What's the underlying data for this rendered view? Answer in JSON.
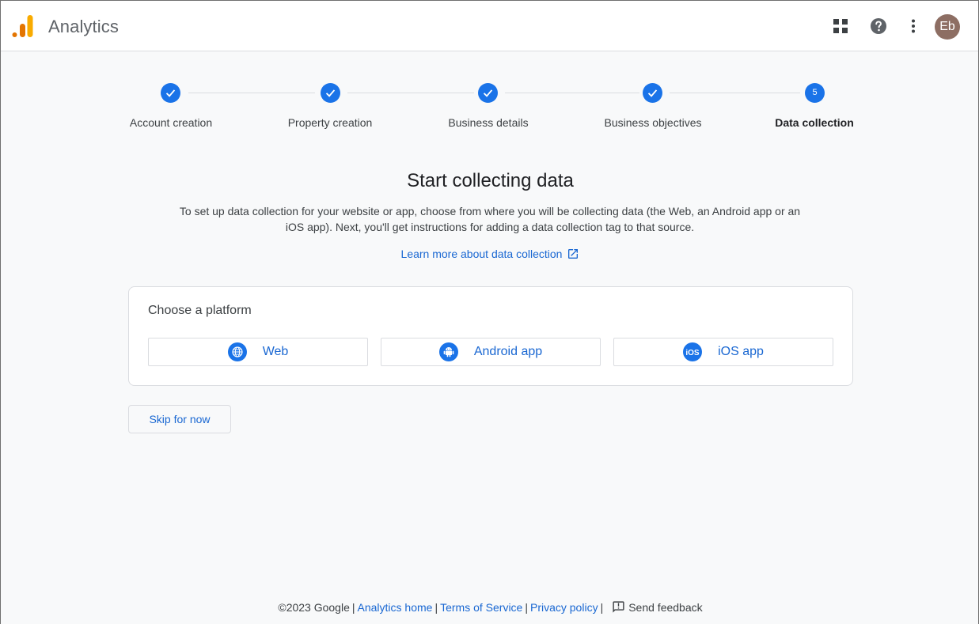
{
  "header": {
    "app_title": "Analytics",
    "avatar_initials": "Eb",
    "icons": [
      "analytics-logo",
      "apps-grid-icon",
      "help-icon",
      "more-vert-icon"
    ]
  },
  "stepper": {
    "steps": [
      {
        "label": "Account creation",
        "state": "complete"
      },
      {
        "label": "Property creation",
        "state": "complete"
      },
      {
        "label": "Business details",
        "state": "complete"
      },
      {
        "label": "Business objectives",
        "state": "complete"
      },
      {
        "label": "Data collection",
        "state": "active",
        "number": "5"
      }
    ]
  },
  "main": {
    "title": "Start collecting data",
    "description": "To set up data collection for your website or app, choose from where you will be collecting data (the Web, an Android app or an iOS app). Next, you'll get instructions for adding a data collection tag to that source.",
    "learn_more": "Learn more about data collection"
  },
  "platform_card": {
    "title": "Choose a platform",
    "options": [
      {
        "label": "Web",
        "icon": "globe-icon"
      },
      {
        "label": "Android app",
        "icon": "android-icon"
      },
      {
        "label": "iOS app",
        "icon": "ios-icon"
      }
    ]
  },
  "skip_label": "Skip for now",
  "footer": {
    "copyright": "©2023 Google",
    "analytics_home": "Analytics home",
    "terms": "Terms of Service",
    "privacy": "Privacy policy",
    "send_feedback": "Send feedback"
  },
  "colors": {
    "accent": "#1a73e8",
    "link": "#1967d2",
    "background": "#f8f9fa",
    "logo_orange": "#f9ab00",
    "logo_dark_orange": "#e37400",
    "avatar": "#8d6e63"
  }
}
